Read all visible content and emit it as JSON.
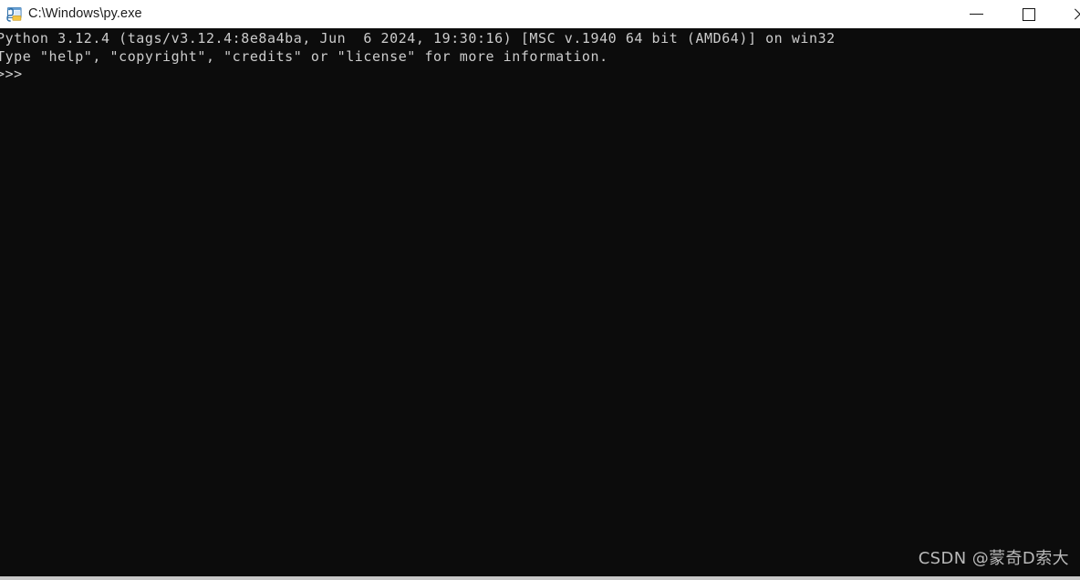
{
  "window": {
    "title": "C:\\Windows\\py.exe",
    "icon_name": "python-console-icon",
    "background_color": "#0c0c0c",
    "titlebar_color": "#ffffff",
    "text_color": "#cccccc"
  },
  "window_controls": {
    "minimize_label": "—",
    "maximize_label": "□",
    "close_label": "✕"
  },
  "console": {
    "lines": [
      "Python 3.12.4 (tags/v3.12.4:8e8a4ba, Jun  6 2024, 19:30:16) [MSC v.1940 64 bit (AMD64)] on win32",
      "Type \"help\", \"copyright\", \"credits\" or \"license\" for more information.",
      ">>>"
    ],
    "text": "Python 3.12.4 (tags/v3.12.4:8e8a4ba, Jun  6 2024, 19:30:16) [MSC v.1940 64 bit (AMD64)] on win32\nType \"help\", \"copyright\", \"credits\" or \"license\" for more information.\n>>>"
  },
  "watermark": {
    "text": "CSDN @蒙奇D索大"
  }
}
